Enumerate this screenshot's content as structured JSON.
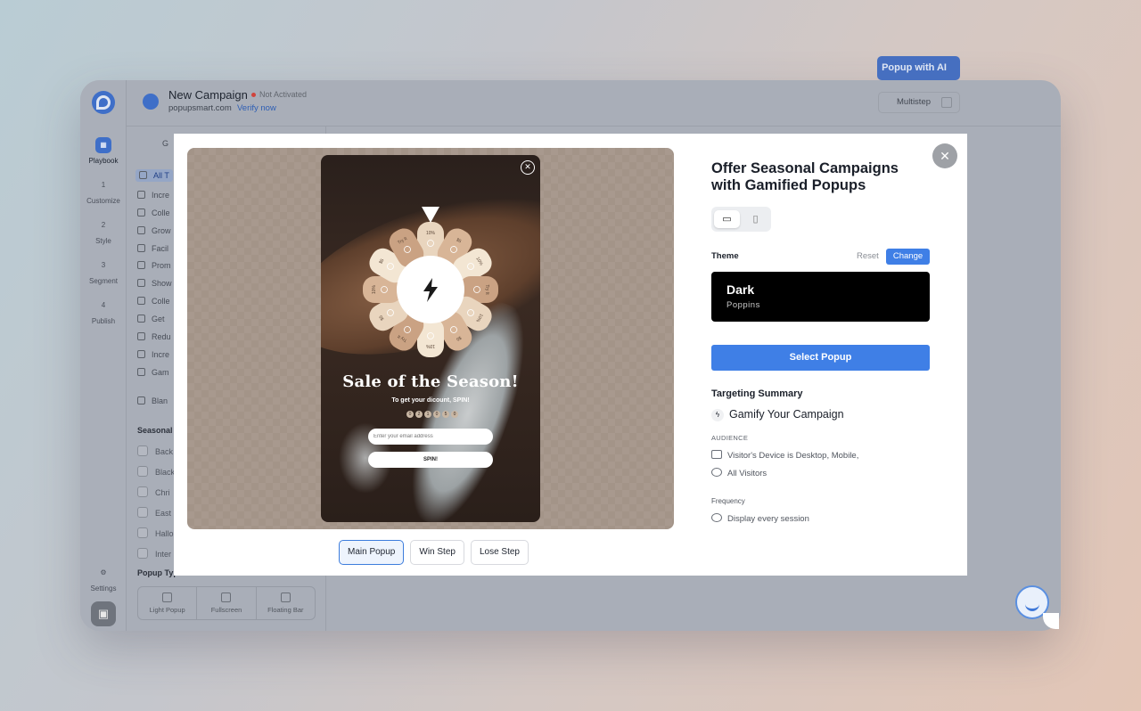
{
  "header": {
    "title": "New Campaign",
    "status": "Not Activated",
    "domain": "popupsmart.com",
    "verify": "Verify now"
  },
  "rail": {
    "items": [
      {
        "num": "",
        "label": "Playbook"
      },
      {
        "num": "1",
        "label": "Customize"
      },
      {
        "num": "2",
        "label": "Style"
      },
      {
        "num": "3",
        "label": "Segment"
      },
      {
        "num": "4",
        "label": "Publish"
      }
    ],
    "settings": "Settings"
  },
  "sidepanel": {
    "tab_partial": "G",
    "categories": [
      "All T",
      "Incre",
      "Colle",
      "Grow",
      "Facil",
      "Prom",
      "Show",
      "Colle",
      "Get",
      "Redu",
      "Incre",
      "Gam"
    ],
    "blank": "Blan",
    "seasonal_label": "Seasonal",
    "seasonal": [
      "Back",
      "Black",
      "Chri",
      "East",
      "Hallo",
      "Inter"
    ],
    "popup_type_label": "Popup Type",
    "popup_types": [
      "Light Popup",
      "Fullscreen",
      "Floating Bar"
    ]
  },
  "toolbar": {
    "ai_button": "Popup with AI",
    "multistep": "Multistep"
  },
  "modal": {
    "title": "Offer Seasonal Campaigns with Gamified Popups",
    "theme_label": "Theme",
    "reset": "Reset",
    "change": "Change",
    "theme_name": "Dark",
    "theme_font": "Poppins",
    "select_button": "Select Popup",
    "targeting_label": "Targeting Summary",
    "gamify": "Gamify Your Campaign",
    "audience_label": "AUDIENCE",
    "audience_device": "Visitor's Device is Desktop, Mobile,",
    "audience_visitors": "All Visitors",
    "frequency_label": "Frequency",
    "frequency_value": "Display every session",
    "step_tabs": [
      "Main Popup",
      "Win Step",
      "Lose Step"
    ],
    "active_step": "Main Popup"
  },
  "popup_preview": {
    "title": "Sale of the Season!",
    "subtitle": "To get your dicount, SPIN!",
    "email_placeholder": "Enter your email address",
    "spin_button": "SPIN!",
    "wheel_labels": [
      "10%",
      "$5",
      "10%",
      "Try It",
      "10%",
      "$5",
      "10%",
      "Try It",
      "$5",
      "10%",
      "$5",
      "Try It"
    ],
    "countdown": [
      "0",
      "2",
      "1",
      "0",
      "5",
      "0"
    ]
  }
}
